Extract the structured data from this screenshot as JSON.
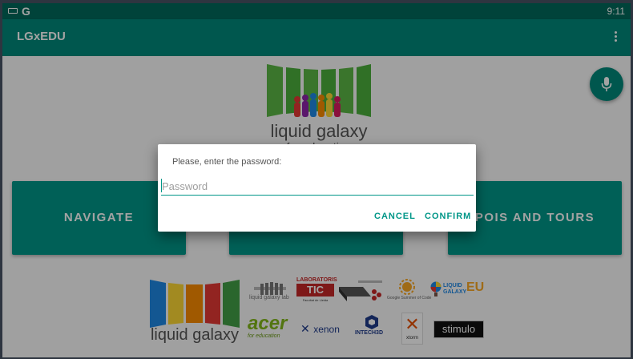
{
  "status_bar": {
    "carrier_icon": "G",
    "time": "9:11"
  },
  "app_bar": {
    "title": "LGxEDU"
  },
  "header_logo": {
    "line1": "liquid galaxy",
    "line2": "for education"
  },
  "buttons": {
    "navigate": "NAVIGATE",
    "middle": "",
    "pois_tours": "POIS AND TOURS"
  },
  "partners": {
    "lg_logo_text": "liquid galaxy",
    "lglab": "liquid galaxy lab",
    "lab_line1": "LABORATORIS",
    "lab_line2": "TIC",
    "lab_sub": "Facultat de Lleida",
    "gsoc": "Google Summer of Code",
    "lg_eu_text1": "LIQUID",
    "lg_eu_text2": "GALAXY",
    "lg_eu_suffix": "EU",
    "acer": "acer",
    "acer_sub": "for education",
    "xenon": "xenon",
    "intech": "INTECH3D",
    "xtorm": "xtorm",
    "stimulo": "stimulo"
  },
  "dialog": {
    "message": "Please, enter the password:",
    "placeholder": "Password",
    "cancel": "CANCEL",
    "confirm": "CONFIRM"
  },
  "colors": {
    "primary": "#00897b",
    "primary_dark": "#00695c",
    "accent": "#009688"
  }
}
